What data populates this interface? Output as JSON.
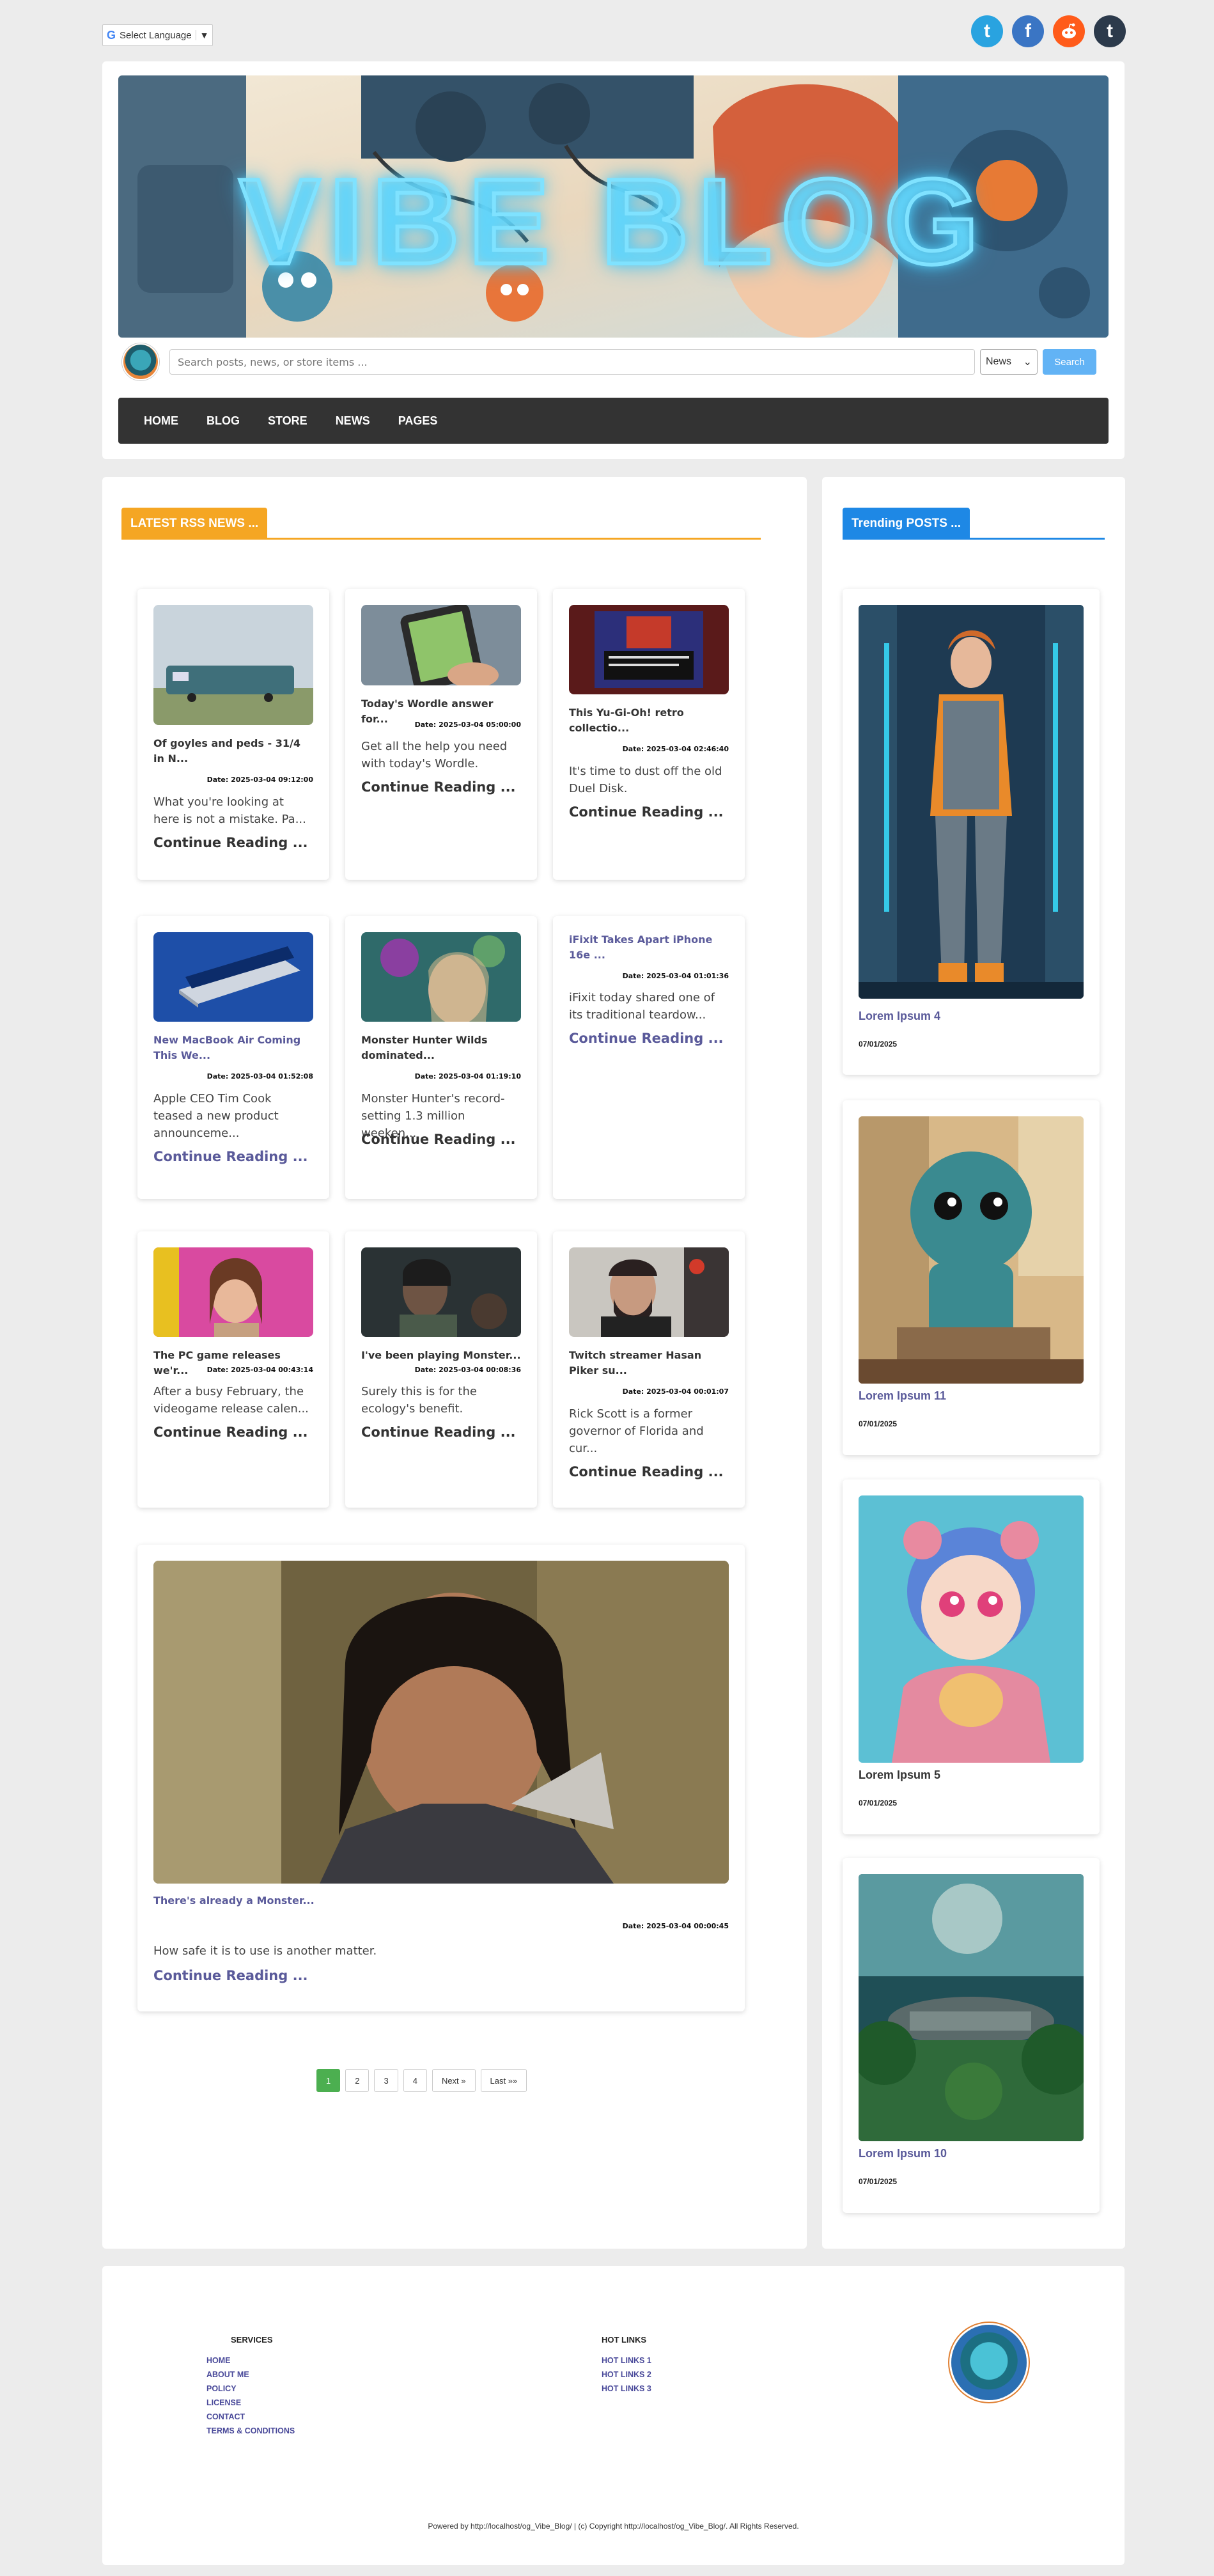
{
  "topbar": {
    "language_label": "Select Language",
    "language_glyph": "G",
    "language_arrow": "▼",
    "social": [
      {
        "name": "twitter",
        "glyph": "t",
        "color": "#29a3e0"
      },
      {
        "name": "facebook",
        "glyph": "f",
        "color": "#3a75c4"
      },
      {
        "name": "reddit",
        "glyph": "●",
        "color": "#ff5b1a"
      },
      {
        "name": "tumblr",
        "glyph": "t",
        "color": "#2c3a4b"
      }
    ]
  },
  "header": {
    "banner_title": "VIBE BLOG",
    "search_placeholder": "Search posts, news, or store items ...",
    "search_category": "News",
    "search_button": "Search",
    "nav": [
      "HOME",
      "BLOG",
      "STORE",
      "NEWS",
      "PAGES"
    ]
  },
  "main": {
    "section_title": "LATEST RSS NEWS ...",
    "accent": "#f5a623",
    "cards": [
      {
        "title": "Of goyles and peds - 31/4 in N...",
        "date": "Date: 2025-03-04 09:12:00",
        "excerpt": "What you're looking at here is not a mistake. Pa...",
        "more": "Continue Reading ..."
      },
      {
        "title": "Today's Wordle answer for...",
        "date": "Date: 2025-03-04 05:00:00",
        "excerpt": "Get all the help you need with today's Wordle.",
        "more": "Continue Reading ..."
      },
      {
        "title": "This Yu-Gi-Oh! retro collectio...",
        "date": "Date: 2025-03-04 02:46:40",
        "excerpt": "It's time to dust off the old Duel Disk.",
        "more": "Continue Reading ..."
      },
      {
        "title": "New MacBook Air Coming This We...",
        "date": "Date: 2025-03-04 01:52:08",
        "excerpt": "Apple CEO Tim Cook teased a new product announceme...",
        "more": "Continue Reading ..."
      },
      {
        "title": "Monster Hunter Wilds dominated...",
        "date": "Date: 2025-03-04 01:19:10",
        "excerpt": "Monster Hunter's record-setting 1.3 million weeken...",
        "more": "Continue Reading ..."
      },
      {
        "title": "iFixit Takes Apart iPhone 16e ...",
        "date": "Date: 2025-03-04 01:01:36",
        "excerpt": "iFixit today shared one of its traditional teardow...",
        "more": "Continue Reading ..."
      },
      {
        "title": "The PC game releases we'r...",
        "date": "Date: 2025-03-04 00:43:14",
        "excerpt": "After a busy February, the videogame release calen...",
        "more": "Continue Reading ..."
      },
      {
        "title": "I've been playing Monster...",
        "date": "Date: 2025-03-04 00:08:36",
        "excerpt": "Surely this is for the ecology's benefit.",
        "more": "Continue Reading ..."
      },
      {
        "title": "Twitch streamer Hasan Piker su...",
        "date": "Date: 2025-03-04 00:01:07",
        "excerpt": "Rick Scott is a former governor of Florida and cur...",
        "more": "Continue Reading ..."
      },
      {
        "title": "There's already a Monster...",
        "date": "Date: 2025-03-04 00:00:45",
        "excerpt": "How safe it is to use is another matter.",
        "more": "Continue Reading ..."
      }
    ],
    "pagination": [
      "1",
      "2",
      "3",
      "4",
      "Next »",
      "Last »»"
    ]
  },
  "sidebar": {
    "section_title": "Trending POSTS ...",
    "accent": "#1e88e5",
    "posts": [
      {
        "title": "Lorem Ipsum 4",
        "date": "07/01/2025"
      },
      {
        "title": "Lorem Ipsum 11",
        "date": "07/01/2025"
      },
      {
        "title": "Lorem Ipsum 5",
        "date": "07/01/2025"
      },
      {
        "title": "Lorem Ipsum 10",
        "date": "07/01/2025"
      }
    ]
  },
  "footer": {
    "services_title": "SERVICES",
    "services": [
      "HOME",
      "ABOUT ME",
      "POLICY",
      "LICENSE",
      "CONTACT",
      "TERMS & CONDITIONS"
    ],
    "hotlinks_title": "HOT LINKS",
    "hotlinks": [
      "HOT LINKS 1",
      "HOT LINKS 2",
      "HOT LINKS 3"
    ],
    "copyright": "Powered by http://localhost/og_Vibe_Blog/ | (c) Copyright http://localhost/og_Vibe_Blog/. All Rights Reserved."
  }
}
